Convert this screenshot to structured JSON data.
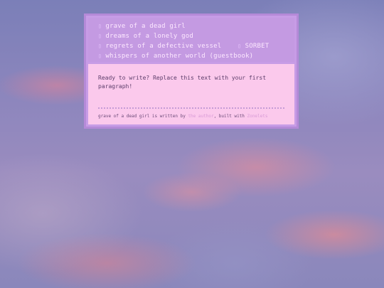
{
  "nav": {
    "items": [
      {
        "label": "grave of a dead girl"
      },
      {
        "label": "dreams of a lonely god"
      },
      {
        "label": "regrets of a defective vessel"
      },
      {
        "label": "SORBET"
      },
      {
        "label": "whispers of another world (guestbook)"
      }
    ],
    "bullet_icon": "small-square-glyph"
  },
  "content": {
    "paragraph": "Ready to write? Replace this text with your first paragraph!"
  },
  "footer": {
    "prefix": "grave of a dead girl is written by ",
    "author_link": "the author",
    "middle": ", built with ",
    "tool_link": "Zonelets"
  },
  "colors": {
    "nav_bg": "#c49ae2",
    "content_bg": "#fbc9ec",
    "border": "#b58ad8",
    "nav_text": "#fde8ff"
  }
}
